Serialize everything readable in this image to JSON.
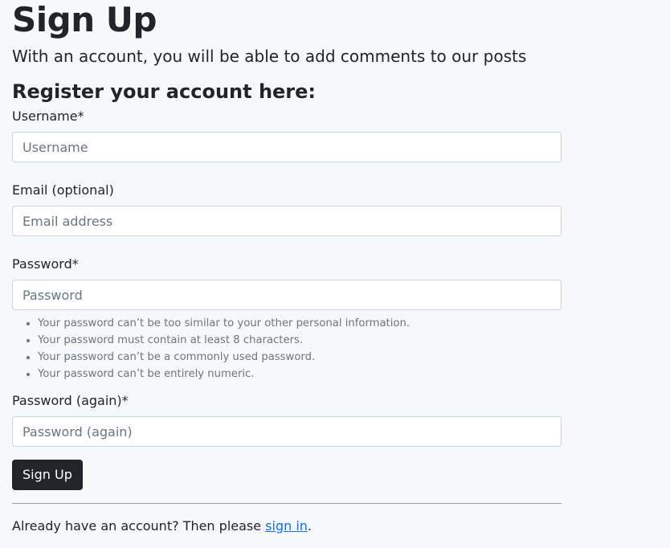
{
  "page": {
    "title": "Sign Up",
    "intro": "With an account, you will be able to add comments to our posts",
    "section_title": "Register your account here:"
  },
  "form": {
    "username": {
      "label": "Username*",
      "placeholder": "Username",
      "value": ""
    },
    "email": {
      "label": "Email (optional)",
      "placeholder": "Email address",
      "value": ""
    },
    "password": {
      "label": "Password*",
      "placeholder": "Password",
      "value": ""
    },
    "password_help": [
      "Your password can’t be too similar to your other personal information.",
      "Your password must contain at least 8 characters.",
      "Your password can’t be a commonly used password.",
      "Your password can’t be entirely numeric."
    ],
    "password_again": {
      "label": "Password (again)*",
      "placeholder": "Password (again)",
      "value": ""
    },
    "submit_label": "Sign Up"
  },
  "footer": {
    "text_before": "Already have an account? Then please ",
    "link_text": "sign in",
    "text_after": "."
  },
  "colors": {
    "background": "#f7f8fa",
    "text": "#212529",
    "muted": "#6c757d",
    "border": "#ced4da",
    "button": "#212529",
    "link": "#0d6efd"
  }
}
